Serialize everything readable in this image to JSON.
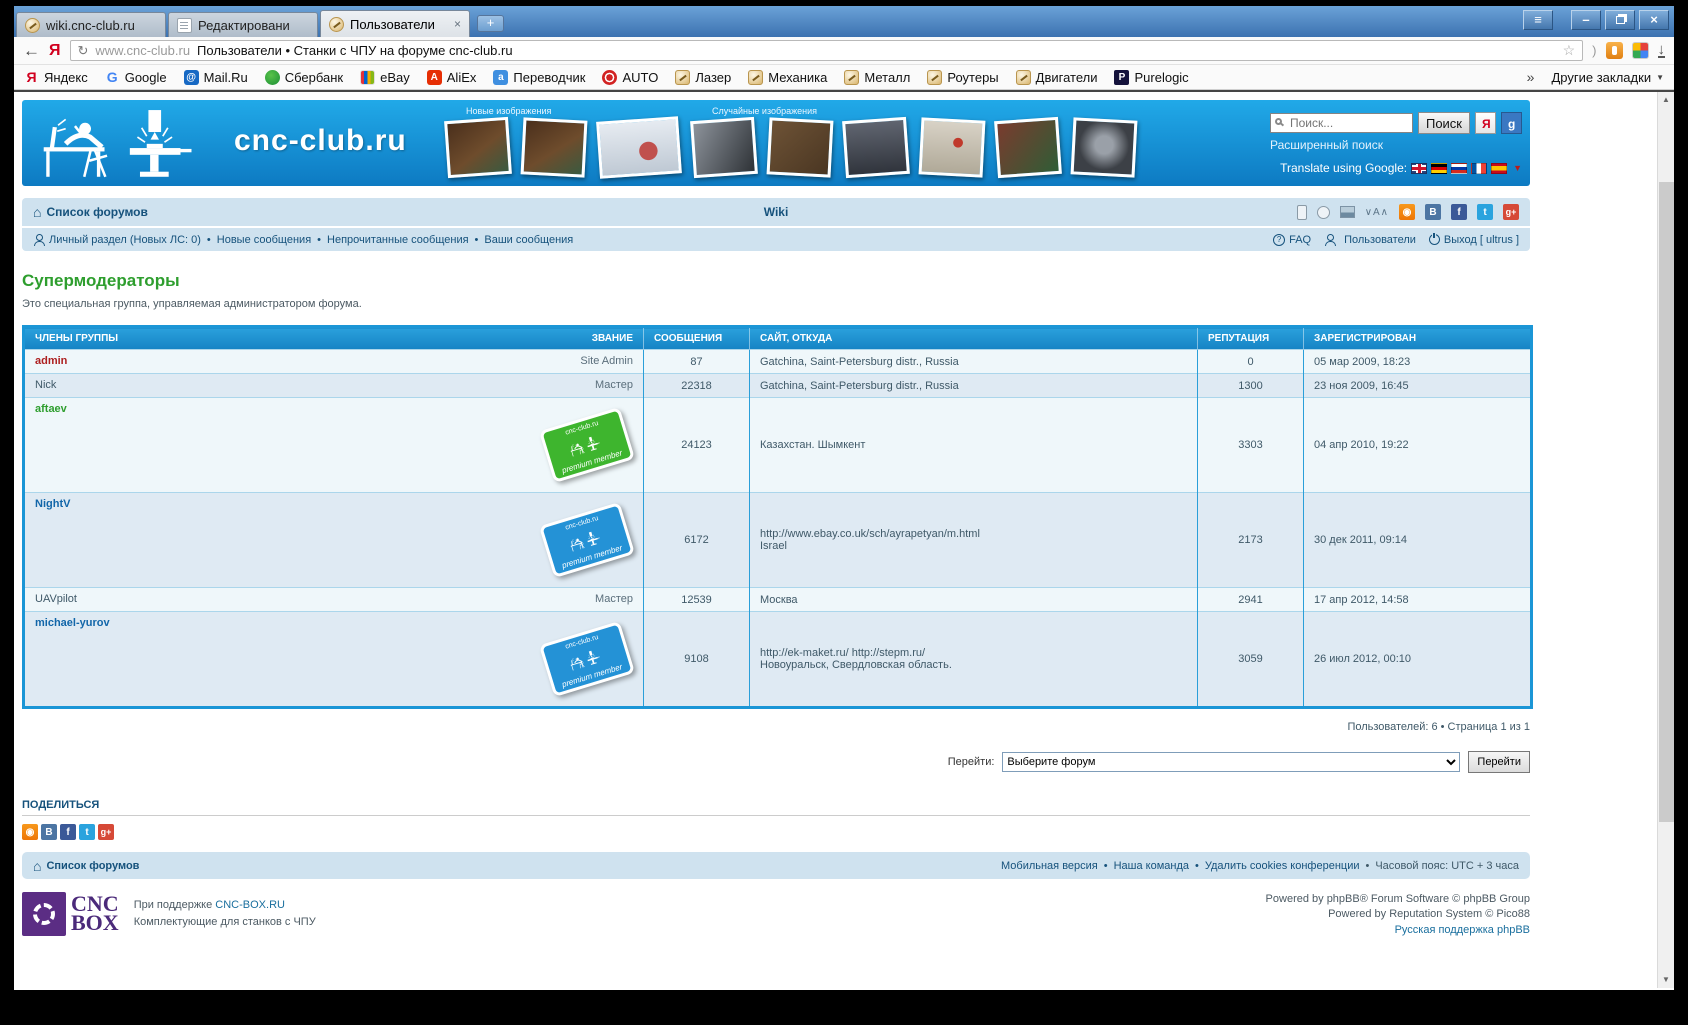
{
  "browser": {
    "tabs": [
      {
        "label": "wiki.cnc-club.ru",
        "icon": "cnc-club-favicon",
        "state": "",
        "close": ""
      },
      {
        "label": "Редактировани",
        "icon": "document-icon",
        "state": "",
        "close": ""
      },
      {
        "label": "Пользователи",
        "icon": "cnc-club-favicon",
        "state": "active",
        "close": "×"
      }
    ],
    "new_tab_label": "+",
    "address": {
      "host": "www.cnc-club.ru",
      "title": "Пользователи • Станки с ЧПУ на форуме cnc-club.ru"
    },
    "bookmarks": [
      {
        "label": "Яндекс",
        "icon": "yandex-icon"
      },
      {
        "label": "Google",
        "icon": "google-icon"
      },
      {
        "label": "Mail.Ru",
        "icon": "mailru-icon"
      },
      {
        "label": "Сбербанк",
        "icon": "sberbank-icon"
      },
      {
        "label": "eBay",
        "icon": "ebay-icon"
      },
      {
        "label": "AliEx",
        "icon": "aliexpress-icon"
      },
      {
        "label": "Переводчик",
        "icon": "translator-icon"
      },
      {
        "label": "AUTO",
        "icon": "auto-icon"
      },
      {
        "label": "Лазер",
        "icon": "cnc-club-favicon"
      },
      {
        "label": "Механика",
        "icon": "cnc-club-favicon"
      },
      {
        "label": "Металл",
        "icon": "cnc-club-favicon"
      },
      {
        "label": "Роутеры",
        "icon": "cnc-club-favicon"
      },
      {
        "label": "Двигатели",
        "icon": "cnc-club-favicon"
      },
      {
        "label": "Purelogic",
        "icon": "purelogic-icon"
      }
    ],
    "bookmarks_overflow": "»",
    "other_bookmarks": "Другие закладки"
  },
  "site_header": {
    "brand": "cnc-club.ru",
    "new_images_label": "Новые изображения",
    "random_images_label": "Случайные изображения",
    "new_thumbs": [
      {
        "kind": "pcb-photo-1"
      },
      {
        "kind": "pcb-photo-2"
      },
      {
        "kind": "cad-screenshot"
      }
    ],
    "random_thumbs": [
      {
        "kind": "cutters-photo"
      },
      {
        "kind": "laser-photo"
      },
      {
        "kind": "engine-photo"
      },
      {
        "kind": "panel-photo"
      },
      {
        "kind": "boards-photo"
      },
      {
        "kind": "pulleys-photo"
      }
    ],
    "search": {
      "placeholder": "Поиск...",
      "button": "Поиск",
      "yandex_button": "Я",
      "google_button": "g",
      "advanced": "Расширенный поиск",
      "translate_label": "Translate using Google:",
      "flags": [
        {
          "icon": "flag-uk"
        },
        {
          "icon": "flag-germany"
        },
        {
          "icon": "flag-russia"
        },
        {
          "icon": "flag-france"
        },
        {
          "icon": "flag-spain"
        }
      ]
    }
  },
  "navbar": {
    "forum_list": "Список форумов",
    "wiki": "Wiki",
    "tool_icons": [
      {
        "icon": "mobile-icon"
      },
      {
        "icon": "feed-icon"
      },
      {
        "icon": "image-icon"
      }
    ],
    "social_icons": [
      {
        "icon": "odnoklassniki-icon"
      },
      {
        "icon": "vk-icon"
      },
      {
        "icon": "facebook-icon"
      },
      {
        "icon": "twitter-icon"
      },
      {
        "icon": "googleplus-icon"
      }
    ],
    "user_links": [
      {
        "label": "Личный раздел (Новых ЛС: 0)"
      },
      {
        "label": "Новые сообщения"
      },
      {
        "label": "Непрочитанные сообщения"
      },
      {
        "label": "Ваши сообщения"
      }
    ],
    "right_links": [
      {
        "icon": "question-icon",
        "label": "FAQ"
      },
      {
        "icon": "user-icon",
        "label": "Пользователи"
      },
      {
        "icon": "power-icon",
        "label": "Выход [ ultrus ]"
      }
    ]
  },
  "group": {
    "title": "Супермодераторы",
    "description": "Это специальная группа, управляемая администратором форума."
  },
  "table": {
    "headers": {
      "members": "ЧЛЕНЫ ГРУППЫ",
      "rank": "ЗВАНИЕ",
      "messages": "СООБЩЕНИЯ",
      "site": "САЙТ, ОТКУДА",
      "reputation": "РЕПУТАЦИЯ",
      "registered": "ЗАРЕГИСТРИРОВАН"
    },
    "badge": {
      "top": "cnc-club.ru",
      "bottom": "premium member"
    },
    "rows": [
      {
        "name": "admin",
        "name_class": "u-admin",
        "rank": "Site Admin",
        "badge": "",
        "messages": "87",
        "site": "Gatchina, Saint-Petersburg distr., Russia",
        "reputation": "0",
        "registered": "05 мар 2009, 18:23"
      },
      {
        "name": "Nick",
        "name_class": "u-plain",
        "rank": "Мастер",
        "badge": "",
        "messages": "22318",
        "site": "Gatchina, Saint-Petersburg distr., Russia",
        "reputation": "1300",
        "registered": "23 ноя 2009, 16:45"
      },
      {
        "name": "aftaev",
        "name_class": "u-green",
        "rank": "",
        "badge": "green",
        "messages": "24123",
        "site": "Казахстан. Шымкент",
        "reputation": "3303",
        "registered": "04 апр 2010, 19:22"
      },
      {
        "name": "NightV",
        "name_class": "u-blue",
        "rank": "",
        "badge": "blue",
        "messages": "6172",
        "site": "http://www.ebay.co.uk/sch/ayrapetyan/m.html\nIsrael",
        "reputation": "2173",
        "registered": "30 дек 2011, 09:14"
      },
      {
        "name": "UAVpilot",
        "name_class": "u-plain",
        "rank": "Мастер",
        "badge": "",
        "messages": "12539",
        "site": "Москва",
        "reputation": "2941",
        "registered": "17 апр 2012, 14:58"
      },
      {
        "name": "michael-yurov",
        "name_class": "u-blue",
        "rank": "",
        "badge": "blue",
        "messages": "9108",
        "site": "http://ek-maket.ru/ http://stepm.ru/\nНовоуральск, Свердловская область.",
        "reputation": "3059",
        "registered": "26 июл 2012, 00:10"
      }
    ]
  },
  "pagination": "Пользователей: 6 • Страница 1 из 1",
  "jump": {
    "label": "Перейти:",
    "selected_option": "Выберите форум",
    "button": "Перейти"
  },
  "share": {
    "title": "ПОДЕЛИТЬСЯ",
    "icons": [
      {
        "icon": "odnoklassniki-icon"
      },
      {
        "icon": "vk-icon"
      },
      {
        "icon": "facebook-icon"
      },
      {
        "icon": "twitter-icon"
      },
      {
        "icon": "googleplus-icon"
      }
    ]
  },
  "bottombar": {
    "forum_list": "Список форумов",
    "links": [
      {
        "label": "Мобильная версия"
      },
      {
        "label": "Наша команда"
      },
      {
        "label": "Удалить cookies конференции"
      }
    ],
    "timezone": "Часовой пояс: UTC + 3 часа"
  },
  "footer": {
    "logo_line1": "CNC",
    "logo_line2": "BOX",
    "support_prefix": "При поддержке",
    "support_link": "CNC-BOX.RU",
    "support_sub": "Комплектующие для станков с ЧПУ",
    "credit1": "Powered by phpBB® Forum Software © phpBB Group",
    "credit2": "Powered by Reputation System © Pico88",
    "credit3": "Русская поддержка phpBB"
  },
  "colors": {
    "accent_blue": "#1b96d6",
    "header_gradient_top": "#21a9e8",
    "header_gradient_bottom": "#0d7ac2",
    "navbar_bg": "#cfe2ef",
    "link": "#16527c",
    "group_title_green": "#2e9e2e",
    "badge_green": "#3eb52e",
    "badge_blue": "#2492d6",
    "admin_red": "#ad1f1f"
  }
}
